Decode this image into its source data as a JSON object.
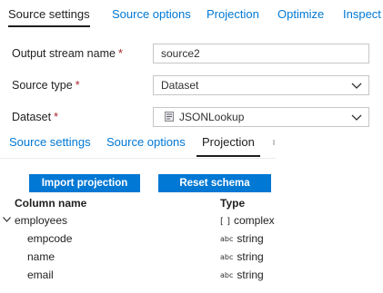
{
  "top_tabs": [
    {
      "label": "Source settings",
      "active": true
    },
    {
      "label": "Source options",
      "active": false
    },
    {
      "label": "Projection",
      "active": false
    },
    {
      "label": "Optimize",
      "active": false
    },
    {
      "label": "Inspect",
      "active": false
    }
  ],
  "form": {
    "output_stream": {
      "label": "Output stream name",
      "required": "*",
      "value": "source2"
    },
    "source_type": {
      "label": "Source type",
      "required": "*",
      "value": "Dataset"
    },
    "dataset": {
      "label": "Dataset",
      "required": "*",
      "value": "JSONLookup"
    }
  },
  "sub_tabs": [
    {
      "label": "Source settings",
      "active": false
    },
    {
      "label": "Source options",
      "active": false
    },
    {
      "label": "Projection",
      "active": true
    }
  ],
  "buttons": {
    "import_projection": "Import projection",
    "reset_schema": "Reset schema"
  },
  "schema": {
    "column_header": "Column name",
    "type_header": "Type",
    "rows": [
      {
        "name": "employees",
        "type_icon": "[ ]",
        "type": "complex",
        "expanded": true
      },
      {
        "name": "empcode",
        "type_icon": "abc",
        "type": "string"
      },
      {
        "name": "name",
        "type_icon": "abc",
        "type": "string"
      },
      {
        "name": "email",
        "type_icon": "abc",
        "type": "string"
      }
    ]
  },
  "colors": {
    "accent": "#0078d4",
    "text": "#201f1e",
    "required": "#a4262c",
    "border": "#c8c6c4"
  },
  "icons": {
    "select_chevron": "chevron-down-icon",
    "dataset": "json-dataset-icon",
    "tree_toggle": "expand-caret-icon"
  }
}
